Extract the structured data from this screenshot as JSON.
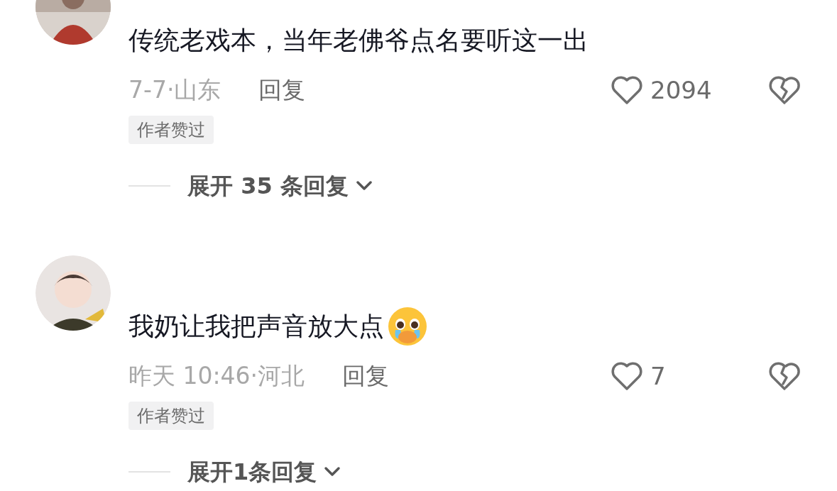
{
  "comments": [
    {
      "text": "传统老戏本，当年老佛爷点名要听这一出",
      "trailing_emoji": false,
      "meta": "7-7·山东",
      "reply_label": "回复",
      "likes": "2094",
      "liked": false,
      "disliked": false,
      "tag": "作者赞过",
      "expand_label": "展开 35 条回复"
    },
    {
      "text": "我奶让我把声音放大点",
      "trailing_emoji": true,
      "meta": "昨天 10:46·河北",
      "reply_label": "回复",
      "likes": "7",
      "liked": false,
      "disliked": false,
      "tag": "作者赞过",
      "expand_label": "展开1条回复"
    }
  ]
}
